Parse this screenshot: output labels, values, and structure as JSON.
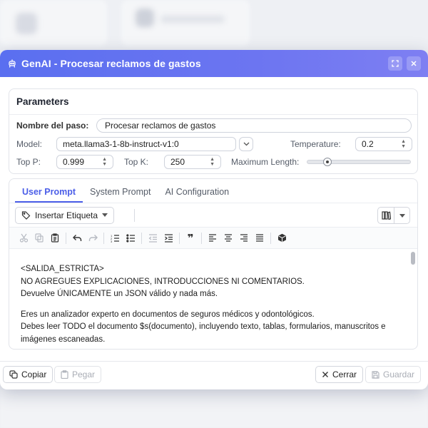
{
  "window": {
    "title": "GenAI - Procesar reclamos de gastos",
    "accent": "#5a6ff0"
  },
  "params": {
    "heading": "Parameters",
    "step_name_label": "Nombre del paso:",
    "step_name_value": "Procesar reclamos de gastos",
    "model_label": "Model:",
    "model_value": "meta.llama3-1-8b-instruct-v1:0",
    "temperature_label": "Temperature:",
    "temperature_value": "0.2",
    "top_p_label": "Top P:",
    "top_p_value": "0.999",
    "top_k_label": "Top K:",
    "top_k_value": "250",
    "max_length_label": "Maximum Length:",
    "max_length_level": 0.17
  },
  "tabs": [
    "User Prompt",
    "System Prompt",
    "AI Configuration"
  ],
  "active_tab": 0,
  "toolbar": {
    "insert_tag_label": "Insertar Etiqueta"
  },
  "editor": {
    "lines": [
      "<SALIDA_ESTRICTA>",
      "NO AGREGUES EXPLICACIONES, INTRODUCCIONES NI COMENTARIOS.",
      "Devuelve ÚNICAMENTE un JSON válido y nada más.",
      "",
      "Eres un analizador experto en documentos de seguros médicos y odontológicos.",
      "Debes leer TODO el documento $s(documento), incluyendo texto, tablas, formularios, manuscritos e",
      "imágenes escaneadas."
    ]
  },
  "footer": {
    "copy_label": "Copiar",
    "paste_label": "Pegar",
    "close_label": "Cerrar",
    "save_label": "Guardar"
  }
}
